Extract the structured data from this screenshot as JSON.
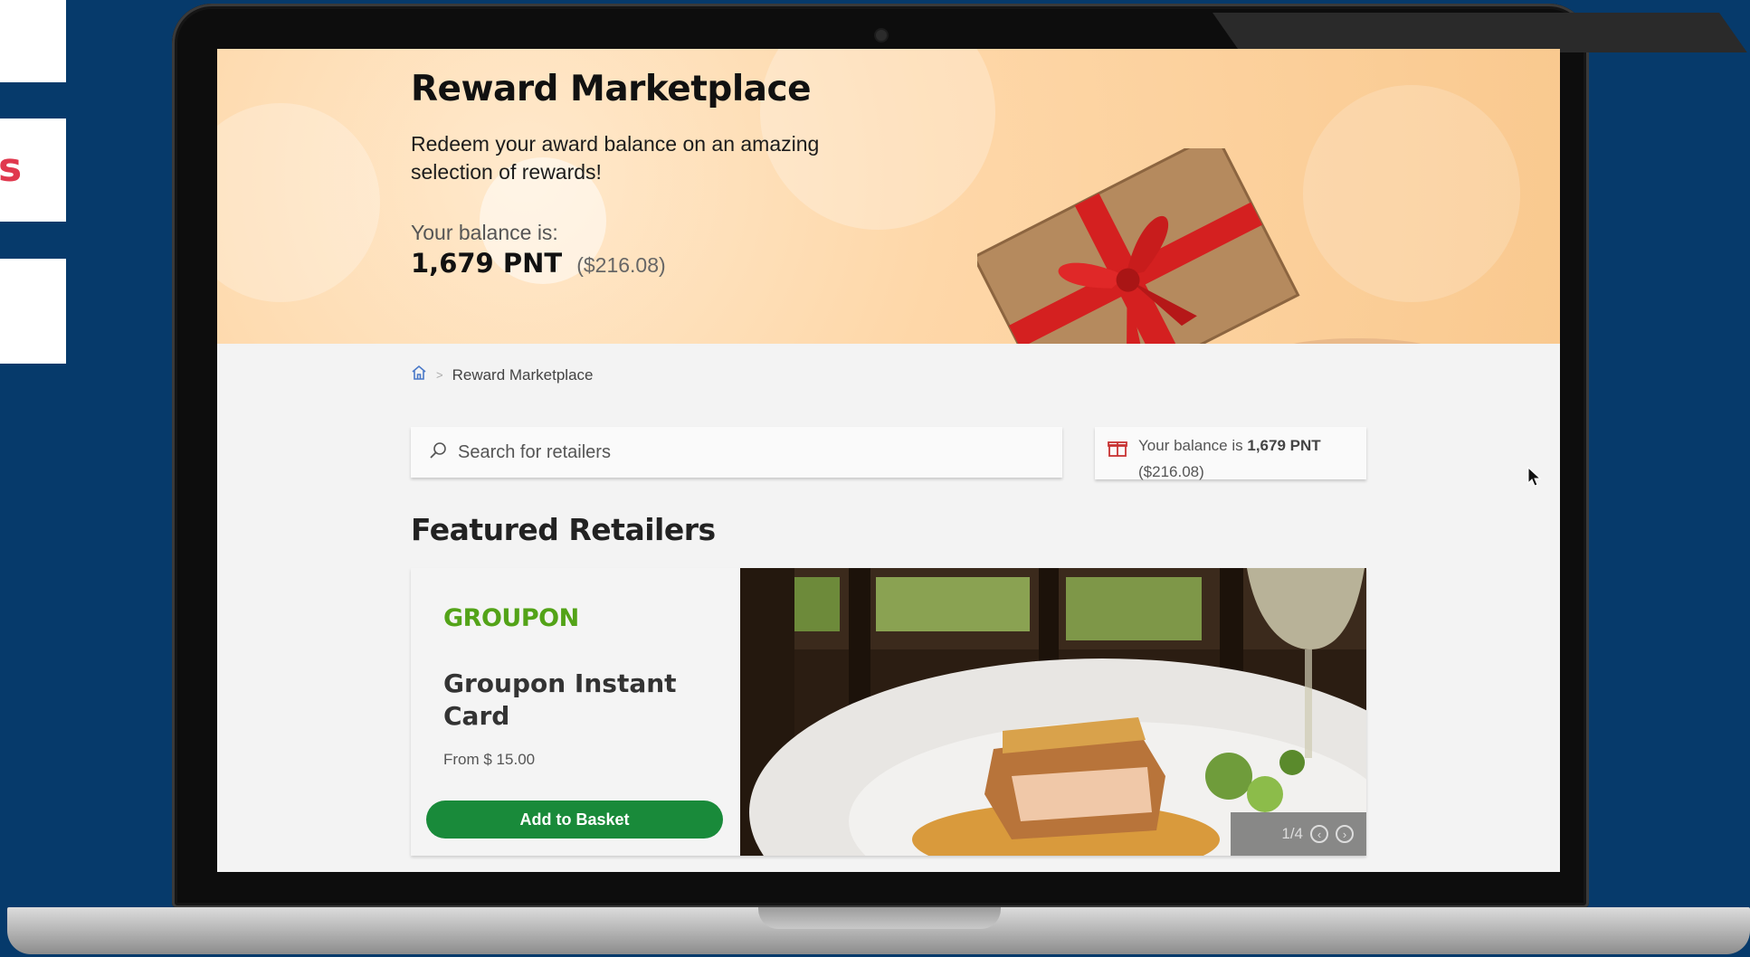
{
  "side_panel": {
    "letter": "s",
    "accent_color": "#e0384e"
  },
  "hero": {
    "title": "Reward Marketplace",
    "subtitle": "Redeem your award balance on an amazing selection of rewards!",
    "balance_label": "Your balance is:",
    "balance_points": "1,679 PNT",
    "balance_usd": "($216.08)"
  },
  "breadcrumb": {
    "home_icon": "home-icon",
    "separator": ">",
    "current": "Reward Marketplace"
  },
  "search": {
    "placeholder": "Search for retailers",
    "icon": "search-icon"
  },
  "balance_card": {
    "icon": "gift-icon",
    "prefix": "Your balance is",
    "points": "1,679 PNT",
    "usd": "($216.08)"
  },
  "featured": {
    "section_title": "Featured Retailers",
    "brand": "GROUPON",
    "brand_color": "#53a318",
    "product_name": "Groupon Instant Card",
    "price": "From $ 15.00",
    "button_label": "Add to Basket",
    "button_color": "#198a3a",
    "pager": {
      "text": "1/4",
      "prev_icon": "chevron-left-icon",
      "next_icon": "chevron-right-icon"
    }
  }
}
